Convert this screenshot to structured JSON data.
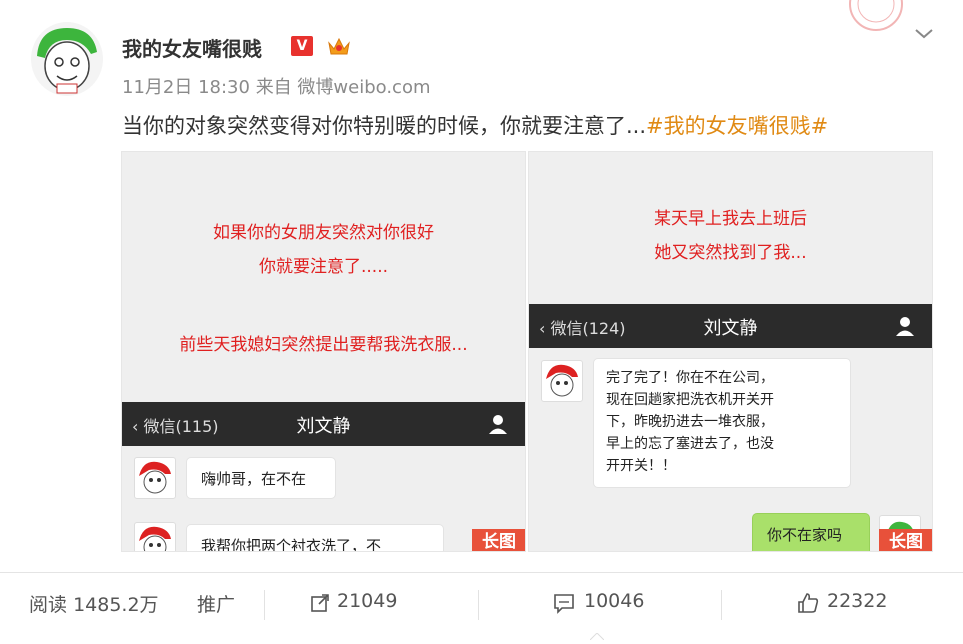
{
  "post": {
    "username": "我的女友嘴很贱",
    "verified_badge": "V",
    "timestamp": "11月2日 18:30",
    "source_prefix": "来自",
    "source": "微博weibo.com",
    "text": "当你的对象突然变得对你特别暖的时候，你就要注意了...",
    "hashtag": "#我的女友嘴很贱#"
  },
  "panel1": {
    "line1": "如果你的女朋友突然对你很好",
    "line2": "你就要注意了.....",
    "line3": "前些天我媳妇突然提出要帮我洗衣服...",
    "chat_back": "微信(115)",
    "chat_title": "刘文静",
    "msg1": "嗨帅哥，在不在",
    "msg2": "我帮你把两个衬衣洗了，不",
    "long_tag": "长图"
  },
  "panel2": {
    "line1": "某天早上我去上班后",
    "line2": "她又突然找到了我...",
    "chat_back": "微信(124)",
    "chat_title": "刘文静",
    "msg1_l1": "完了完了！你在不在公司，",
    "msg1_l2": "现在回趟家把洗衣机开关开",
    "msg1_l3": "下，昨晚扔进去一堆衣服，",
    "msg1_l4": "早上的忘了塞进去了，也没",
    "msg1_l5": "开开关！！",
    "msg2": "你不在家吗",
    "long_tag": "长图"
  },
  "footer": {
    "reads_label": "阅读",
    "reads_value": "1485.2万",
    "promote": "推广",
    "reposts": "21049",
    "comments": "10046",
    "likes": "22322"
  },
  "colors": {
    "hashtag": "#e08a14",
    "red_text": "#e02020",
    "badge": "#e8322e",
    "long_tag": "#e8513a",
    "chat_bar": "#2b2b2b",
    "green_bubble": "#a9e06a"
  },
  "icons": [
    "chevron-down-icon",
    "verified-icon",
    "crown-icon",
    "repost-icon",
    "comment-icon",
    "like-icon",
    "user-icon"
  ]
}
